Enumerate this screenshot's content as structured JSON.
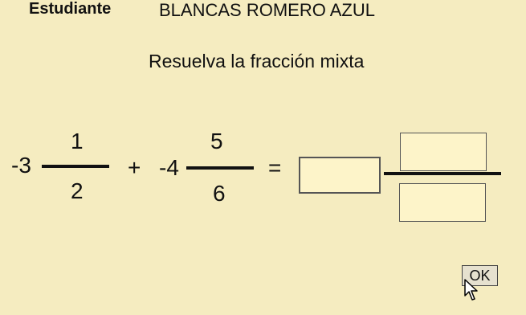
{
  "header": {
    "student_label": "Estudiante",
    "student_name": "BLANCAS ROMERO AZUL"
  },
  "instruction": "Resuelva la fracción mixta",
  "expression": {
    "term1": {
      "whole": "-3",
      "numerator": "1",
      "denominator": "2"
    },
    "operator": "+",
    "term2": {
      "whole": "-4",
      "numerator": "5",
      "denominator": "6"
    },
    "equals": "="
  },
  "answer": {
    "whole_value": "",
    "numerator_value": "",
    "denominator_value": ""
  },
  "ok_button": {
    "label": "OK"
  },
  "icons": {
    "cursor": "mouse-pointer-icon"
  }
}
